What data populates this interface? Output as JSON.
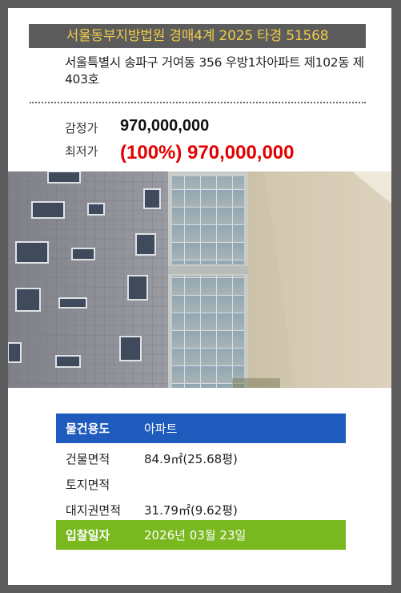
{
  "banner": {
    "title": "서울동부지방법원 경매4계 2025 타경 51568"
  },
  "address": {
    "text": "서울특별시 송파구 거여동 356 우방1차아파트 제102동 제403호"
  },
  "prices": {
    "appraisal_label": "감정가",
    "appraisal_value": "970,000,000",
    "minimum_label": "최저가",
    "minimum_value": "(100%) 970,000,000"
  },
  "photo": {
    "alt": "apartment-building-photo"
  },
  "details": [
    {
      "label": "물건용도",
      "value": "아파트"
    },
    {
      "label": "건물면적",
      "value": "84.9㎡(25.68평)"
    },
    {
      "label": "토지면적",
      "value": ""
    },
    {
      "label": "대지권면적",
      "value": "31.79㎡(9.62평)"
    },
    {
      "label": "입찰일자",
      "value": "2026년 03월 23일"
    }
  ],
  "colors": {
    "banner_bg": "#5c5c5c",
    "banner_text": "#f0cc4a",
    "min_price": "#e50000",
    "row_blue": "#1f5bbd",
    "row_green": "#79b81f"
  }
}
